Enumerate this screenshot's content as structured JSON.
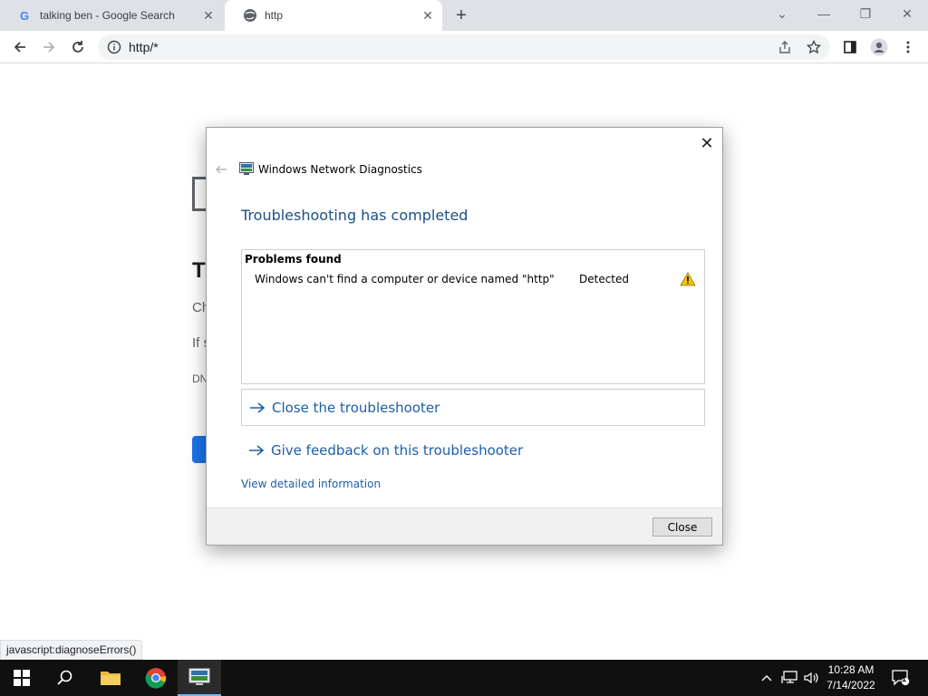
{
  "browser": {
    "tabs": [
      {
        "title": "talking ben - Google Search",
        "favicon": "google-g-icon"
      },
      {
        "title": "http",
        "favicon": "globe-icon",
        "active": true
      }
    ],
    "address": "http/*",
    "status_url": "javascript:diagnoseErrors()"
  },
  "dialog": {
    "app_title": "Windows Network Diagnostics",
    "heading": "Troubleshooting has completed",
    "problems_header": "Problems found",
    "problems": [
      {
        "description": "Windows can't find a computer or device named \"http\"",
        "status": "Detected",
        "icon": "warning-icon"
      }
    ],
    "links": [
      {
        "label": "Close the troubleshooter"
      },
      {
        "label": "Give feedback on this troubleshooter"
      }
    ],
    "details_link": "View detailed information",
    "close_button": "Close"
  },
  "background_page": {
    "title_fragment": "T",
    "line1_fragment": "Ch",
    "line2_fragment": "If s",
    "line3_fragment": "DN"
  },
  "taskbar": {
    "time": "10:28 AM",
    "date": "7/14/2022",
    "notification_count": "1"
  },
  "colors": {
    "accent_link": "#1b5fa8",
    "heading": "#1b4f8a",
    "taskbar": "#101010",
    "warning": "#f2c500"
  }
}
